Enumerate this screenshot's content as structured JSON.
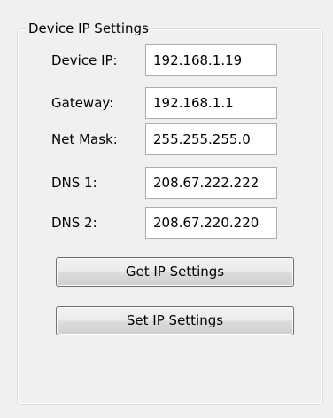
{
  "group": {
    "title": "Device IP Settings"
  },
  "fields": {
    "device_ip": {
      "label": "Device IP:",
      "value": "192.168.1.19"
    },
    "gateway": {
      "label": "Gateway:",
      "value": "192.168.1.1"
    },
    "net_mask": {
      "label": "Net Mask:",
      "value": "255.255.255.0"
    },
    "dns1": {
      "label": "DNS 1:",
      "value": "208.67.222.222"
    },
    "dns2": {
      "label": "DNS 2:",
      "value": "208.67.220.220"
    }
  },
  "buttons": {
    "get_label": "Get IP Settings",
    "set_label": "Set IP Settings"
  }
}
